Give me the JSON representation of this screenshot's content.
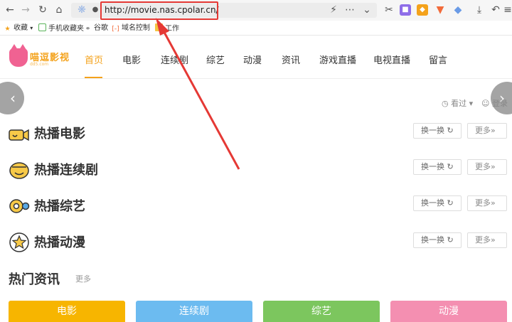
{
  "browser": {
    "url": "http://movie.nas.cpolar.cn/",
    "icons": [
      "back-icon",
      "forward-icon",
      "reload-icon",
      "home-icon",
      "lightning-icon",
      "more-icon",
      "chevron-down-icon",
      "cut-icon",
      "extension-icon",
      "shield-icon",
      "game-icon",
      "download-icon",
      "undo-icon",
      "menu-icon"
    ]
  },
  "bookmarks": {
    "favorites": "收藏",
    "items": [
      "手机收藏夹",
      "谷歌",
      "域名控制",
      "工作"
    ]
  },
  "site": {
    "logo_title": "喵逗影视",
    "logo_sub": "dd5.com",
    "nav": [
      "首页",
      "电影",
      "连续剧",
      "综艺",
      "动漫",
      "资讯",
      "游戏直播",
      "电视直播",
      "留言"
    ],
    "history_label": "看过",
    "login_label": "登录"
  },
  "sections": [
    {
      "title": "热播电影",
      "refresh": "换一换",
      "more": "更多"
    },
    {
      "title": "热播连续剧",
      "refresh": "换一换",
      "more": "更多"
    },
    {
      "title": "热播综艺",
      "refresh": "换一换",
      "more": "更多"
    },
    {
      "title": "热播动漫",
      "refresh": "换一换",
      "more": "更多"
    }
  ],
  "news": {
    "title": "热门资讯",
    "more": "更多"
  },
  "tags": [
    {
      "label": "电影",
      "color": "#f7b500"
    },
    {
      "label": "连续剧",
      "color": "#6cbbf0"
    },
    {
      "label": "综艺",
      "color": "#7cc65e"
    },
    {
      "label": "动漫",
      "color": "#f48fb1"
    }
  ],
  "colors": {
    "accent": "#f4a21b",
    "annotation": "#e53935"
  }
}
